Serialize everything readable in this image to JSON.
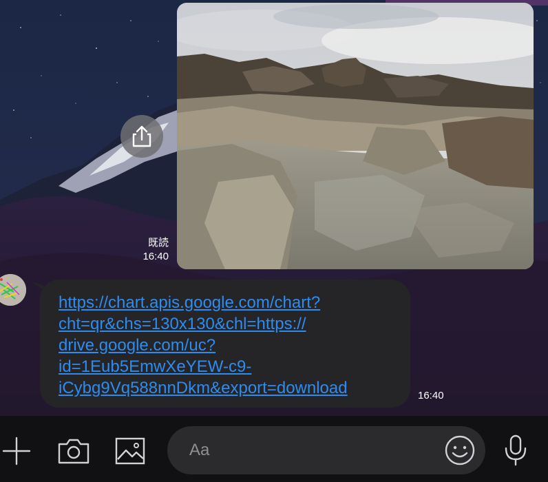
{
  "photo_message": {
    "read_label": "既読",
    "time": "16:40",
    "share_icon": "share-icon"
  },
  "incoming_message": {
    "lines": [
      "https://chart.apis.google.com/chart?",
      "cht=qr&chs=130x130&chl=https://",
      "drive.google.com/uc?",
      "id=1Eub5EmwXeYEW-c9-",
      "iCybg9Vq588nnDkm&export=download"
    ],
    "time": "16:40",
    "link_color": "#2d8cf0"
  },
  "input_bar": {
    "placeholder": "Aa",
    "icons": [
      "plus-icon",
      "camera-icon",
      "image-icon",
      "emoji-icon",
      "microphone-icon"
    ]
  }
}
